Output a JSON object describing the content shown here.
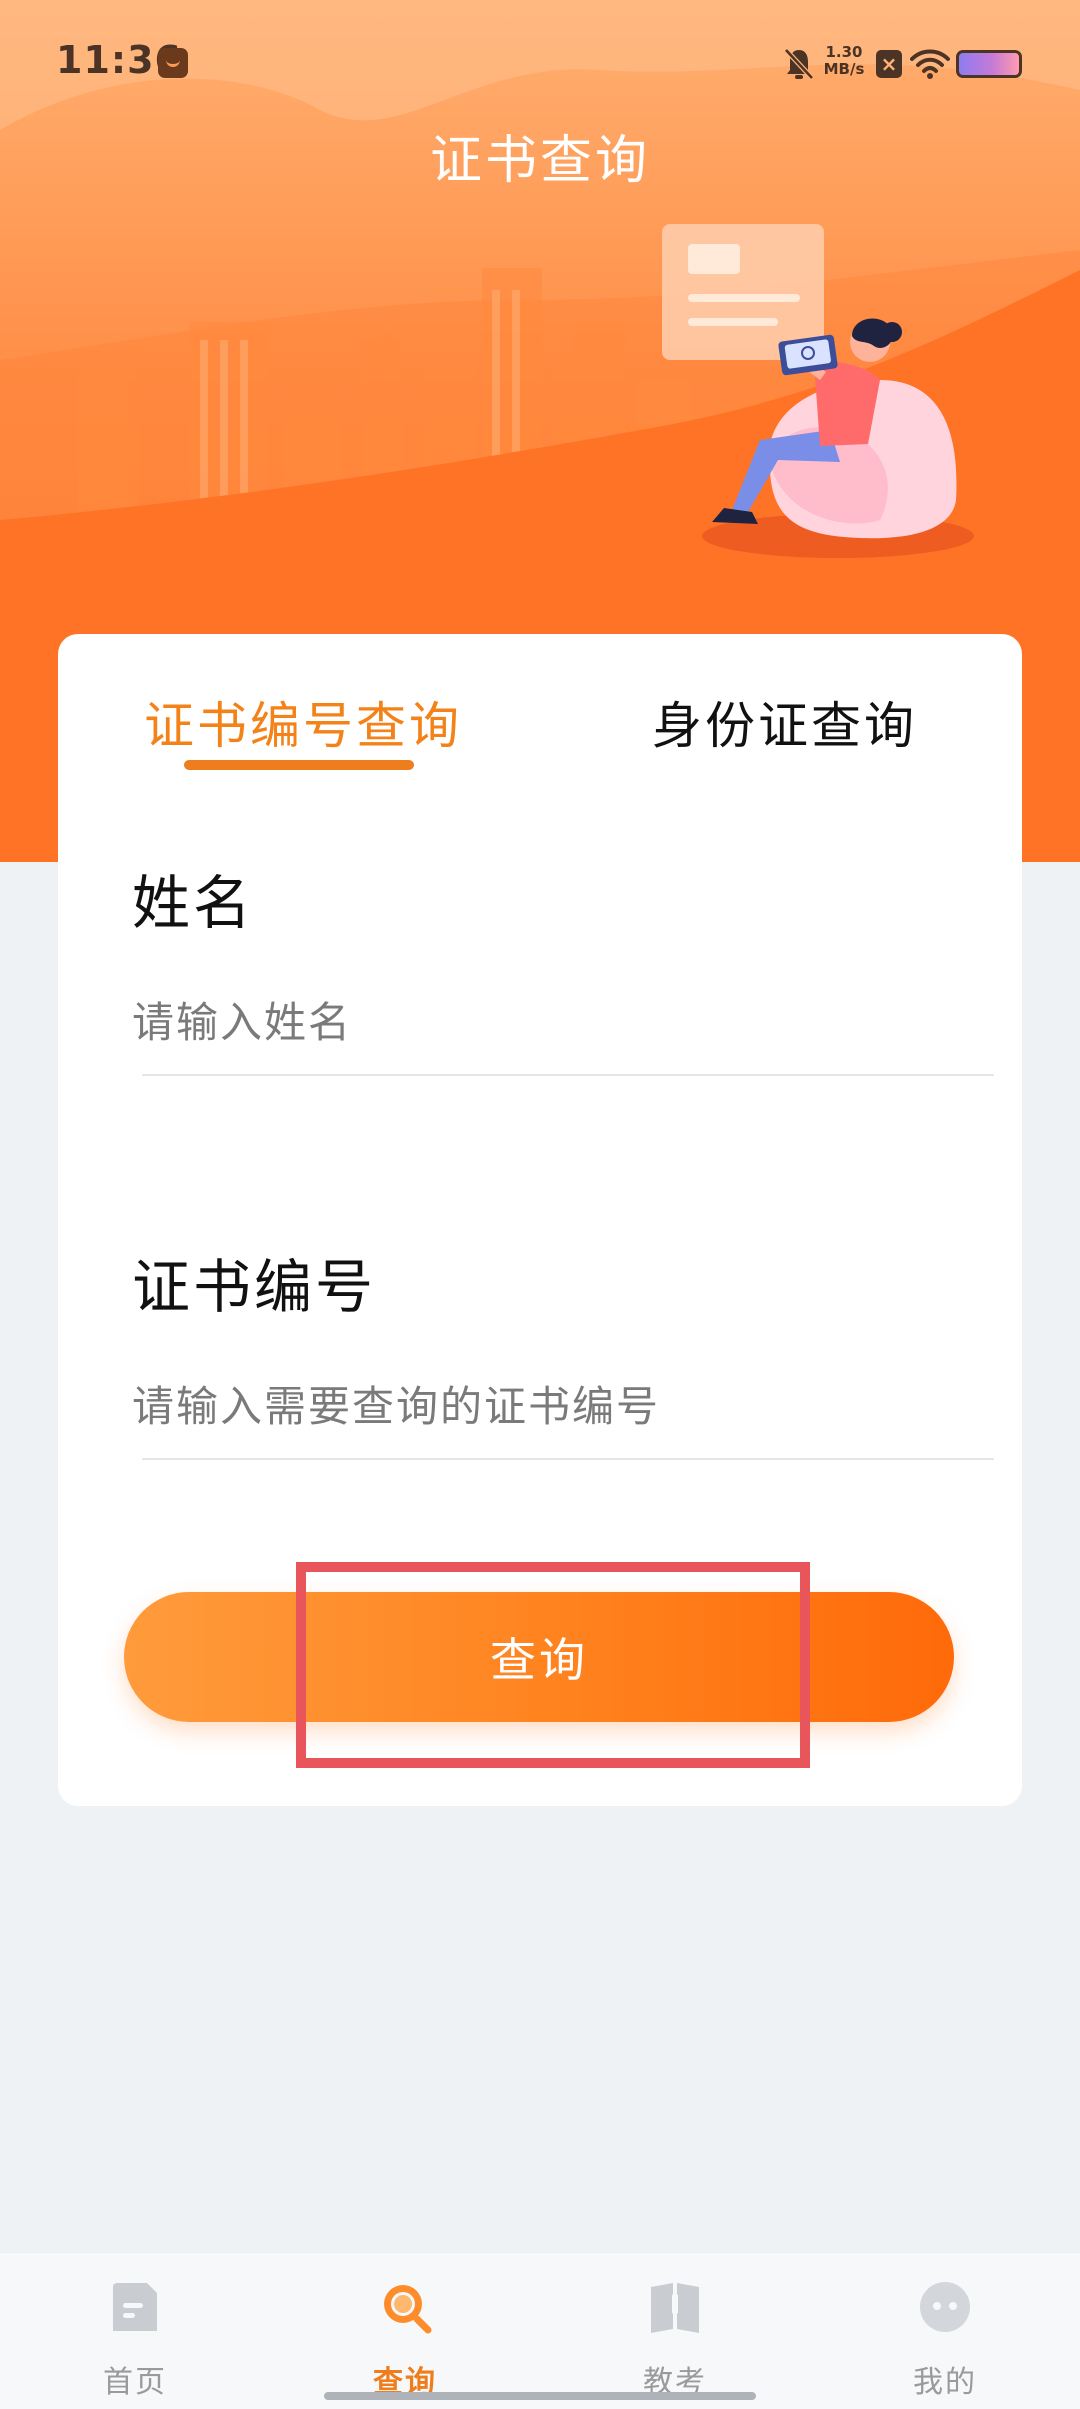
{
  "status_bar": {
    "time": "11:36",
    "net_speed_value": "1.30",
    "net_speed_unit": "MB/s"
  },
  "header": {
    "title": "证书查询"
  },
  "tabs": [
    {
      "label": "证书编号查询",
      "active": true
    },
    {
      "label": "身份证查询",
      "active": false
    }
  ],
  "form": {
    "name_label": "姓名",
    "name_placeholder": "请输入姓名",
    "name_value": "",
    "cert_label": "证书编号",
    "cert_placeholder": "请输入需要查询的证书编号",
    "cert_value": "",
    "submit_label": "查询"
  },
  "bottom_nav": [
    {
      "label": "首页",
      "icon": "document-icon",
      "active": false
    },
    {
      "label": "查询",
      "icon": "search-icon",
      "active": true
    },
    {
      "label": "教考",
      "icon": "book-icon",
      "active": false
    },
    {
      "label": "我的",
      "icon": "profile-face-icon",
      "active": false
    }
  ],
  "colors": {
    "accent": "#f38219",
    "button_start": "#ff9b3c",
    "button_end": "#ff6a0a",
    "highlight": "#e8555a",
    "background": "#eff2f5"
  }
}
